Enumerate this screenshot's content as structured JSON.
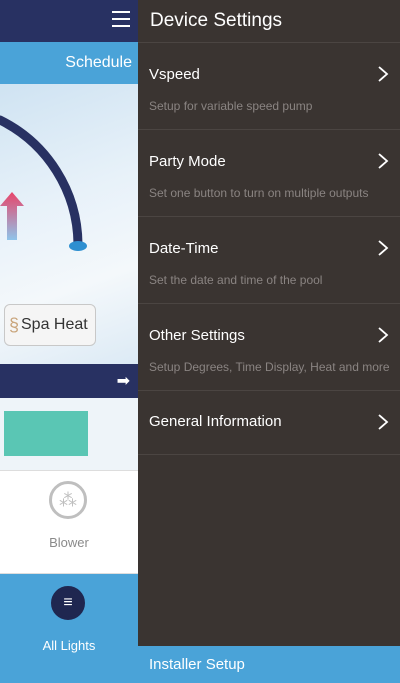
{
  "background_app": {
    "schedule_label": "Schedule",
    "spa_heat_label": "Spa Heat",
    "blower_label": "Blower",
    "all_lights_label": "All Lights"
  },
  "drawer": {
    "title": "Device Settings",
    "items": [
      {
        "label": "Vspeed",
        "subtitle": "Setup for variable speed pump"
      },
      {
        "label": "Party Mode",
        "subtitle": "Set one button to turn on multiple outputs"
      },
      {
        "label": "Date-Time",
        "subtitle": "Set the date and time of the pool"
      },
      {
        "label": "Other Settings",
        "subtitle": "Setup Degrees, Time Display, Heat and more"
      },
      {
        "label": "General Information",
        "subtitle": ""
      }
    ],
    "footer_label": "Installer Setup"
  },
  "colors": {
    "drawer_bg": "#3a3431",
    "accent_blue": "#4aa3d8",
    "navy": "#283162",
    "teal": "#5ac6b4"
  },
  "icons": [
    "menu-icon",
    "chevron-right-icon",
    "arrow-right-icon",
    "blower-icon",
    "lightbulb-icon",
    "steam-icon",
    "temperature-arrow-icon"
  ]
}
